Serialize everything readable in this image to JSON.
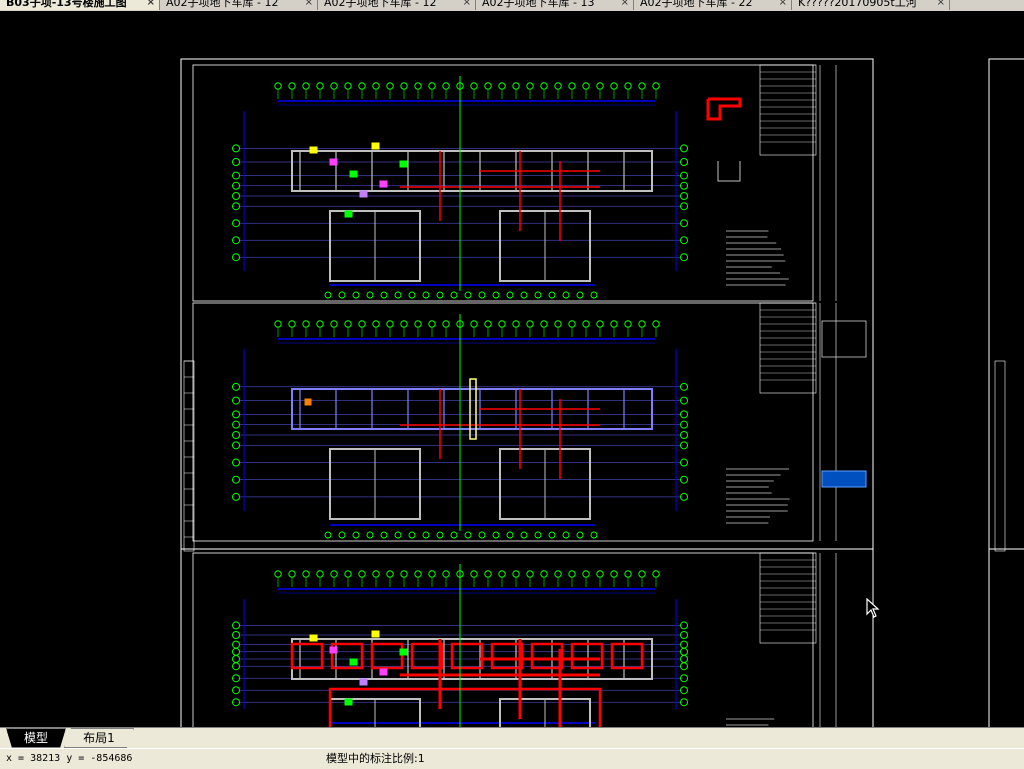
{
  "doc_tabs": [
    {
      "label": "B03子项-13号楼施工图",
      "active": true
    },
    {
      "label": "A02子项地下车库 - 12",
      "active": false
    },
    {
      "label": "A02子项地下车库 - 12",
      "active": false
    },
    {
      "label": "A02子项地下车库 - 13",
      "active": false
    },
    {
      "label": "A02子项地下车库 - 22",
      "active": false
    },
    {
      "label": "K?????20170905t工河",
      "active": false
    }
  ],
  "close_glyph": "×",
  "layout_tabs": {
    "model": "模型",
    "layout1": "布局1"
  },
  "status": {
    "coords": "x = 38213  y = -854686",
    "scale_label": "模型中的标注比例:1"
  },
  "colors": {
    "background": "#000000",
    "grid": "#0000ff",
    "axis_bubble": "#00ff00",
    "wall": "#ff0000",
    "frame": "#ffffff"
  }
}
